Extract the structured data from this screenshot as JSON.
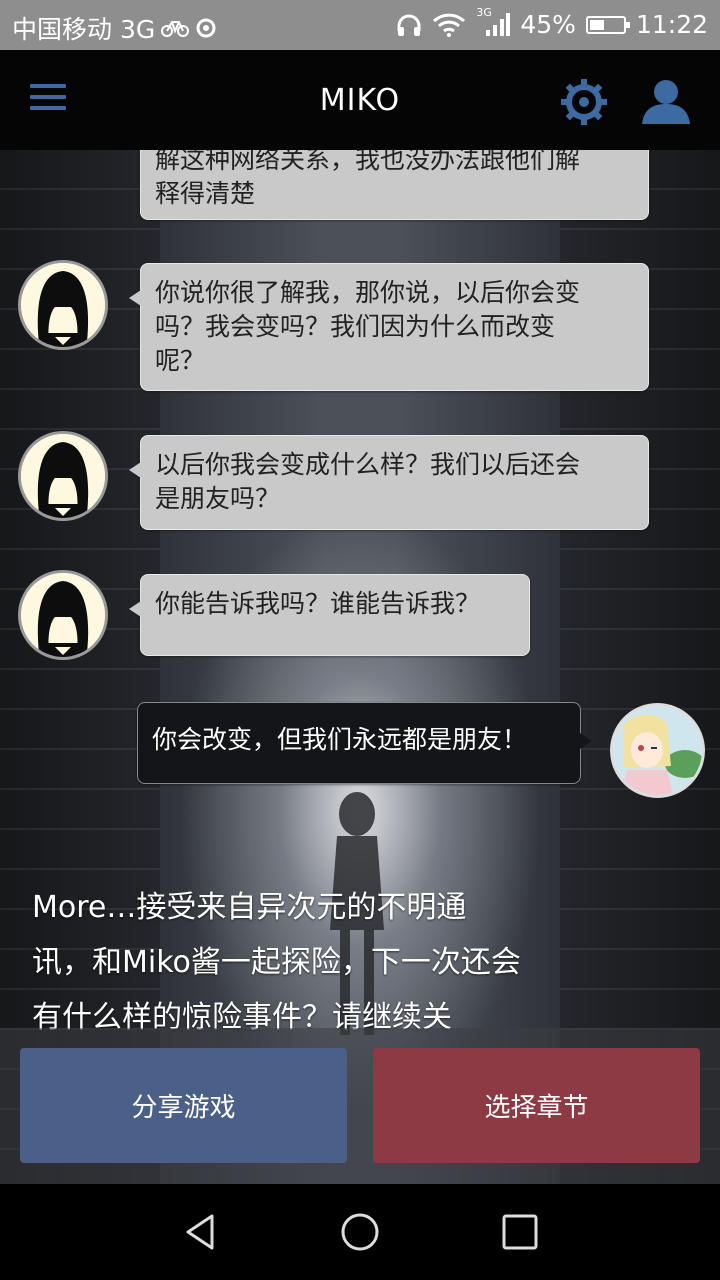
{
  "status_bar": {
    "carrier": "中国移动 3G",
    "network_badge": "3G",
    "battery": "45%",
    "battery_level": 0.45,
    "time": "11:22",
    "icons": [
      "bike-icon",
      "loading-icon",
      "headphones-icon",
      "wifi-icon",
      "signal-icon",
      "battery-icon"
    ]
  },
  "app_bar": {
    "title": "MIKO",
    "accent": "#3d6aa0",
    "icons": [
      "menu-icon",
      "gear-icon",
      "user-icon"
    ]
  },
  "chat": {
    "messages": [
      {
        "sender": "miko",
        "text": "解这种网络关系，我也没办法跟他们解\n释得清楚"
      },
      {
        "sender": "miko",
        "text": "你说你很了解我，那你说，以后你会变\n吗？我会变吗？我们因为什么而改变\n呢？"
      },
      {
        "sender": "miko",
        "text": "以后你我会变成什么样？我们以后还会\n是朋友吗？"
      },
      {
        "sender": "miko",
        "text": "你能告诉我吗？谁能告诉我？"
      },
      {
        "sender": "player",
        "text": "你会改变，但我们永远都是朋友！"
      }
    ]
  },
  "narration": {
    "lines": [
      "More…接受来自异次元的不明通",
      "讯，和Miko酱一起探险，下一次还会",
      "有什么样的惊险事件？请继续关"
    ]
  },
  "buttons": {
    "share": "分享游戏",
    "chapter": "选择章节",
    "share_color": "#4b6088",
    "chapter_color": "#8d3a45"
  },
  "nav_bar": {
    "icons": [
      "back-icon",
      "home-icon",
      "recents-icon"
    ]
  }
}
